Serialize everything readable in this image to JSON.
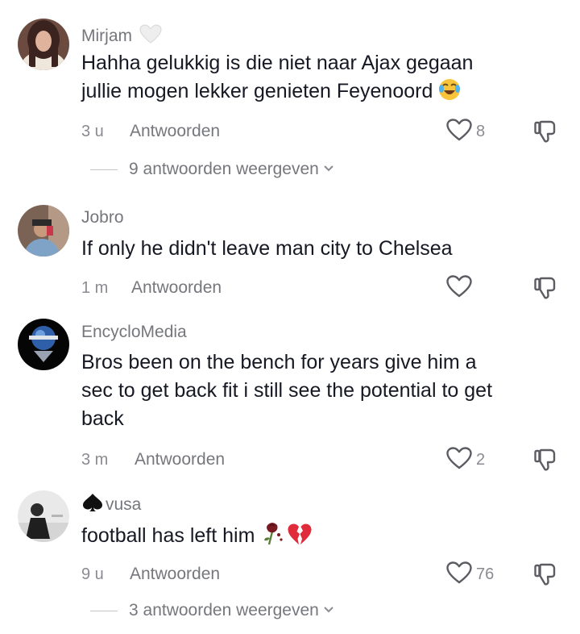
{
  "comments": [
    {
      "username": "Mirjam",
      "username_icon": "white-heart-icon",
      "text_lines": [
        "Hahha gelukkig is die niet naar Ajax gegaan",
        "jullie mogen lekker genieten Feyenoord"
      ],
      "text_emoji": "face-with-tears-of-joy-icon",
      "time": "3 u",
      "reply_label": "Antwoorden",
      "likes": "8",
      "view_replies": "9 antwoorden weergeven"
    },
    {
      "username": "Jobro",
      "text_lines": [
        "If only he didn't leave man city to Chelsea"
      ],
      "time": "1 m",
      "reply_label": "Antwoorden",
      "likes": ""
    },
    {
      "username": "EncycloMedia",
      "text_lines": [
        "Bros been on the bench for years give him a",
        "sec to get back fit i still see the potential to get",
        "back"
      ],
      "time": "3 m",
      "reply_label": "Antwoorden",
      "likes": "2"
    },
    {
      "username": "vusa",
      "username_prefix_icon": "spade-icon",
      "text_lines": [
        "football has left him"
      ],
      "text_emoji": "wilted-rose-and-broken-heart-icons",
      "time": "9 u",
      "reply_label": "Antwoorden",
      "likes": "76",
      "view_replies": "3 antwoorden weergeven"
    }
  ],
  "colors": {
    "text": "#161823",
    "secondary": "#76777c",
    "muted": "#8a8b91",
    "icon_stroke": "#5c5d63"
  }
}
